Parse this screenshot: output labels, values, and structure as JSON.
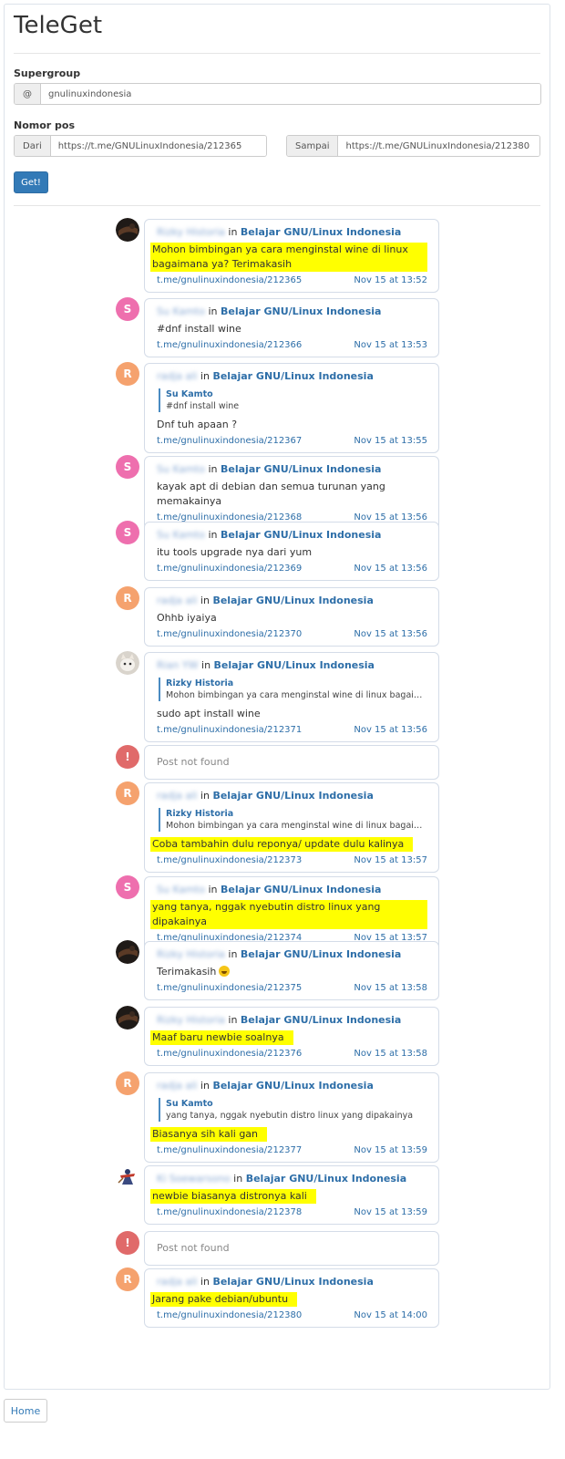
{
  "app": {
    "title": "TeleGet"
  },
  "form": {
    "supergroup_label": "Supergroup",
    "supergroup_prefix": "@",
    "supergroup_value": "gnulinuxindonesia",
    "post_label": "Nomor pos",
    "from_label": "Dari",
    "from_value": "https://t.me/GNULinuxIndonesia/212365",
    "to_label": "Sampai",
    "to_value": "https://t.me/GNULinuxIndonesia/212380",
    "get_button": "Get!"
  },
  "group_name": "Belajar GNU/Linux Indonesia",
  "in_word": "in",
  "not_found_text": "Post not found",
  "posts": [
    {
      "avatar": "photo-dark",
      "author": "Rizky Historia",
      "text": "Mohon bimbingan ya cara menginstal wine di linux bagaimana ya? Terimakasih",
      "highlight": true,
      "link": "t.me/gnulinuxindonesia/212365",
      "time": "Nov 15 at 13:52"
    },
    {
      "avatar": "S",
      "avatar_color": "#ee6fae",
      "author": "Su Kamto",
      "text": "#dnf install wine",
      "highlight": false,
      "link": "t.me/gnulinuxindonesia/212366",
      "time": "Nov 15 at 13:53"
    },
    {
      "avatar": "R",
      "avatar_color": "#f5a26e",
      "author": "radja ali",
      "quote_author": "Su Kamto",
      "quote_text": "#dnf install wine",
      "text": "Dnf tuh apaan ?",
      "highlight": false,
      "link": "t.me/gnulinuxindonesia/212367",
      "time": "Nov 15 at 13:55"
    },
    {
      "avatar": "S",
      "avatar_color": "#ee6fae",
      "author": "Su Kamto",
      "text": "kayak apt di debian dan semua turunan yang memakainya",
      "highlight": false,
      "link": "t.me/gnulinuxindonesia/212368",
      "time": "Nov 15 at 13:56"
    },
    {
      "avatar": "S",
      "avatar_color": "#ee6fae",
      "author": "Su Kamto",
      "text": "itu tools upgrade nya dari yum",
      "highlight": false,
      "link": "t.me/gnulinuxindonesia/212369",
      "time": "Nov 15 at 13:56"
    },
    {
      "avatar": "R",
      "avatar_color": "#f5a26e",
      "author": "radja ali",
      "text": "Ohhb iyaiya",
      "highlight": false,
      "link": "t.me/gnulinuxindonesia/212370",
      "time": "Nov 15 at 13:56"
    },
    {
      "avatar": "photo-cat",
      "author": "Rian YW",
      "quote_author": "Rizky Historia",
      "quote_text": "Mohon bimbingan ya cara menginstal wine di linux bagaimana y...",
      "text": "sudo apt install wine",
      "highlight": false,
      "link": "t.me/gnulinuxindonesia/212371",
      "time": "Nov 15 at 13:56"
    },
    {
      "not_found": true,
      "avatar": "!",
      "avatar_color": "#e06a6a"
    },
    {
      "avatar": "R",
      "avatar_color": "#f5a26e",
      "author": "radja ali",
      "quote_author": "Rizky Historia",
      "quote_text": "Mohon bimbingan ya cara menginstal wine di linux bagaimana y...",
      "text": "Coba tambahin dulu reponya/ update dulu kalinya",
      "highlight": true,
      "link": "t.me/gnulinuxindonesia/212373",
      "time": "Nov 15 at 13:57"
    },
    {
      "avatar": "S",
      "avatar_color": "#ee6fae",
      "author": "Su Kamto",
      "text": "yang tanya, nggak nyebutin distro linux yang dipakainya",
      "highlight": true,
      "link": "t.me/gnulinuxindonesia/212374",
      "time": "Nov 15 at 13:57"
    },
    {
      "avatar": "photo-dark",
      "author": "Rizky Historia",
      "text": "Terimakasih",
      "emoji": true,
      "highlight": false,
      "link": "t.me/gnulinuxindonesia/212375",
      "time": "Nov 15 at 13:58"
    },
    {
      "avatar": "photo-dark",
      "author": "Rizky Historia",
      "text": "Maaf baru newbie soalnya",
      "highlight": true,
      "link": "t.me/gnulinuxindonesia/212376",
      "time": "Nov 15 at 13:58"
    },
    {
      "avatar": "R",
      "avatar_color": "#f5a26e",
      "author": "radja ali",
      "quote_author": "Su Kamto",
      "quote_text": "yang tanya, nggak nyebutin distro linux yang dipakainya",
      "text": "Biasanya sih kali gan",
      "highlight": true,
      "link": "t.me/gnulinuxindonesia/212377",
      "time": "Nov 15 at 13:59"
    },
    {
      "avatar": "photo-figure",
      "author": "Ki Soewarsono",
      "text": "newbie biasanya distronya kali",
      "highlight": true,
      "link": "t.me/gnulinuxindonesia/212378",
      "time": "Nov 15 at 13:59"
    },
    {
      "not_found": true,
      "avatar": "!",
      "avatar_color": "#e06a6a"
    },
    {
      "avatar": "R",
      "avatar_color": "#f5a26e",
      "author": "radja ali",
      "text": "Jarang pake debian/ubuntu",
      "highlight": true,
      "link": "t.me/gnulinuxindonesia/212380",
      "time": "Nov 15 at 14:00"
    }
  ],
  "home_button": "Home"
}
